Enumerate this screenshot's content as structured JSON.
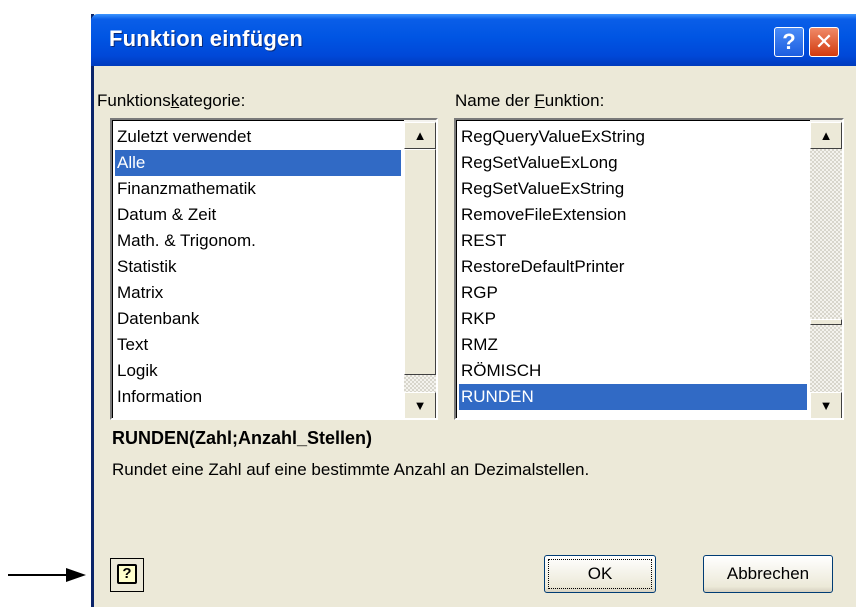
{
  "window": {
    "title": "Funktion einfügen",
    "help_glyph": "?",
    "close_glyph": "✕"
  },
  "category": {
    "label_prefix": "Funktions",
    "label_accel": "k",
    "label_suffix": "ategorie:",
    "items": [
      "Zuletzt verwendet",
      "Alle",
      "Finanzmathematik",
      "Datum & Zeit",
      "Math. & Trigonom.",
      "Statistik",
      "Matrix",
      "Datenbank",
      "Text",
      "Logik",
      "Information"
    ],
    "selected": "Alle"
  },
  "functions": {
    "label_prefix": "Name der ",
    "label_accel": "F",
    "label_suffix": "unktion:",
    "items": [
      "RegQueryValueExString",
      "RegSetValueExLong",
      "RegSetValueExString",
      "RemoveFileExtension",
      "REST",
      "RestoreDefaultPrinter",
      "RGP",
      "RKP",
      "RMZ",
      "RÖMISCH",
      "RUNDEN"
    ],
    "selected": "RUNDEN"
  },
  "syntax": "RUNDEN(Zahl;Anzahl_Stellen)",
  "description": "Rundet eine Zahl auf eine bestimmte Anzahl an Dezimalstellen.",
  "buttons": {
    "ok": "OK",
    "cancel": "Abbrechen",
    "help_icon": "?"
  },
  "scroll_arrows": {
    "up": "▲",
    "down": "▼"
  },
  "icons": {
    "help": "question-mark-icon",
    "close": "close-icon",
    "annotation": "arrow-right-icon"
  }
}
